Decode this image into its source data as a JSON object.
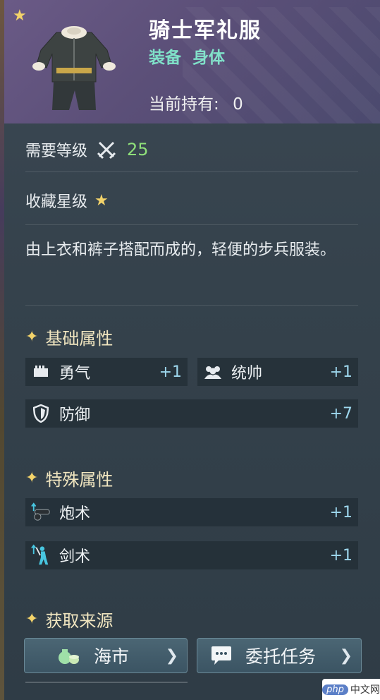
{
  "item": {
    "name": "骑士军礼服",
    "type_label": "装备",
    "slot_label": "身体",
    "own_label": "当前持有:",
    "own_count": "0",
    "collect_stars": 1
  },
  "level": {
    "label": "需要等级",
    "value": "25"
  },
  "collect": {
    "label": "收藏星级"
  },
  "description": "由上衣和裤子搭配而成的，轻便的步兵服装。",
  "sections": {
    "basic": "基础属性",
    "special": "特殊属性",
    "source": "获取来源"
  },
  "basic_attrs": [
    {
      "name": "勇气",
      "value": "+1",
      "icon": "courage-icon"
    },
    {
      "name": "统帅",
      "value": "+1",
      "icon": "leadership-icon"
    },
    {
      "name": "防御",
      "value": "+7",
      "icon": "shield-icon"
    }
  ],
  "special_attrs": [
    {
      "name": "炮术",
      "value": "+1",
      "icon": "cannon-icon"
    },
    {
      "name": "剑术",
      "value": "+1",
      "icon": "swordsman-icon"
    }
  ],
  "sources": [
    {
      "label": "海市",
      "icon": "money-bag-icon"
    },
    {
      "label": "委托任务",
      "icon": "chat-bubble-icon"
    }
  ],
  "watermark": {
    "brand": "php",
    "text": "中文网"
  },
  "colors": {
    "header": "#5b4f78",
    "accent_green": "#8fe07a",
    "value_blue": "#9ed8ee",
    "star": "#f3d36a"
  }
}
